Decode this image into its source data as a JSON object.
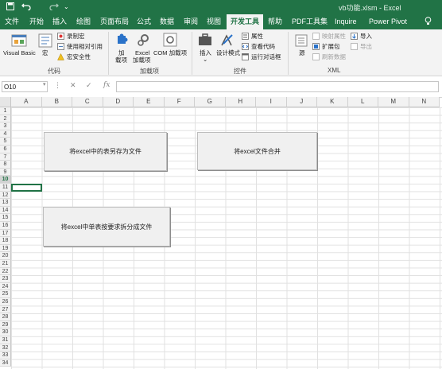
{
  "titlebar": {
    "title": "vb功能.xlsm  -  Excel",
    "save_icon": "save-icon",
    "undo_icon": "undo-icon",
    "redo_icon": "redo-icon",
    "accent": "#217346"
  },
  "tabs": [
    "文件",
    "开始",
    "插入",
    "绘图",
    "页面布局",
    "公式",
    "数据",
    "审阅",
    "视图",
    "开发工具",
    "帮助",
    "PDF工具集",
    "Inquire",
    "Power Pivot"
  ],
  "active_tab": "开发工具",
  "ribbon": {
    "code": {
      "label": "代码",
      "visual_basic": "Visual Basic",
      "macros": "宏",
      "record_macro": "录制宏",
      "use_relative": "使用相对引用",
      "macro_security": "宏安全性"
    },
    "addins": {
      "label": "加载项",
      "addins_line1": "加",
      "addins_line2": "载项",
      "excel_addins_line1": "Excel",
      "excel_addins_line2": "加载项",
      "com_addins": "COM 加载项"
    },
    "controls": {
      "label": "控件",
      "insert": "插入",
      "design_mode": "设计模式",
      "properties": "属性",
      "view_code": "查看代码",
      "run_dialog": "运行对话框"
    },
    "xml": {
      "label": "XML",
      "source": "源",
      "map_properties": "映射属性",
      "expansion_packs": "扩展包",
      "refresh_data": "刷新数据",
      "import": "导入",
      "export": "导出"
    }
  },
  "formula_bar": {
    "name_box": "O10",
    "fx": "fx",
    "value": ""
  },
  "sheet": {
    "columns": [
      "A",
      "B",
      "C",
      "D",
      "E",
      "F",
      "G",
      "H",
      "I",
      "J",
      "K",
      "L",
      "M",
      "N"
    ],
    "rows": [
      "1",
      "2",
      "3",
      "4",
      "5",
      "6",
      "7",
      "8",
      "9",
      "10",
      "11",
      "12",
      "13",
      "14",
      "15",
      "16",
      "17",
      "18",
      "19",
      "20",
      "21",
      "22",
      "23",
      "24",
      "25",
      "26",
      "27",
      "28",
      "29",
      "30",
      "31",
      "32",
      "33",
      "34"
    ],
    "selected_row": "10"
  },
  "buttons": {
    "save_sheet_as_file": "将excel中的表另存为文件",
    "merge_files": "将excel文件合并",
    "split_sheet": "将excel中单表按要求拆分成文件"
  }
}
